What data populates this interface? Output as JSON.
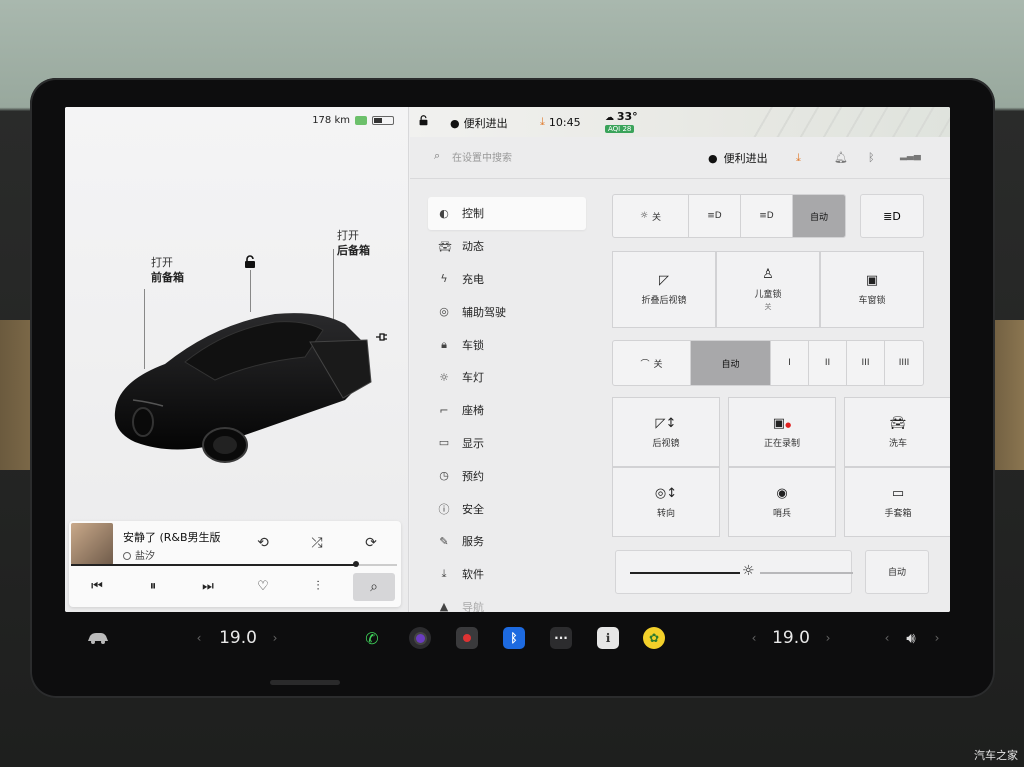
{
  "vehicle": {
    "range": "178 km",
    "frunk_callout": {
      "action": "打开",
      "target": "前备箱"
    },
    "trunk_callout": {
      "action": "打开",
      "target": "后备箱"
    },
    "lock_icon": "unlock-icon",
    "charge_icon": "charge-port-icon"
  },
  "media": {
    "title": "安静了 (R&B男生版",
    "artist": "盐汐",
    "progress": 0.87,
    "buttons": [
      "replay-icon",
      "shuffle-icon",
      "repeat-icon",
      "prev-icon",
      "pause-icon",
      "next-icon",
      "heart-icon",
      "equalizer-icon",
      "search-icon"
    ]
  },
  "status_bar": {
    "profile": "便利进出",
    "time": "10:45",
    "temperature": "33°",
    "aqi": "AQI 28"
  },
  "search": {
    "placeholder": "在设置中搜索",
    "profile": "便利进出"
  },
  "nav": [
    {
      "label": "控制",
      "icon": "toggle-icon",
      "active": true
    },
    {
      "label": "动态",
      "icon": "car-icon"
    },
    {
      "label": "充电",
      "icon": "bolt-icon"
    },
    {
      "label": "辅助驾驶",
      "icon": "steering-wheel-icon"
    },
    {
      "label": "车锁",
      "icon": "lock-icon"
    },
    {
      "label": "车灯",
      "icon": "light-icon"
    },
    {
      "label": "座椅",
      "icon": "seat-icon"
    },
    {
      "label": "显示",
      "icon": "display-icon"
    },
    {
      "label": "预约",
      "icon": "clock-icon"
    },
    {
      "label": "安全",
      "icon": "info-icon"
    },
    {
      "label": "服务",
      "icon": "wrench-icon"
    },
    {
      "label": "软件",
      "icon": "download-icon"
    },
    {
      "label": "导航",
      "icon": "navigation-icon"
    }
  ],
  "lights": {
    "off": "关",
    "auto": "自动",
    "active": "自动"
  },
  "tiles_row1": [
    {
      "label": "折叠后视镜",
      "icon": "mirror-fold-icon",
      "sub": ""
    },
    {
      "label": "儿童锁",
      "icon": "child-lock-icon",
      "sub": "关"
    },
    {
      "label": "车窗锁",
      "icon": "window-lock-icon",
      "sub": ""
    }
  ],
  "wipers": {
    "off": "关",
    "auto": "自动",
    "levels": [
      "I",
      "II",
      "III",
      "IIII"
    ],
    "active": "自动"
  },
  "tiles_grid": [
    {
      "label": "后视镜",
      "icon": "mirror-adjust-icon"
    },
    {
      "label": "正在录制",
      "icon": "dashcam-icon"
    },
    {
      "label": "洗车",
      "icon": "car-wash-icon"
    },
    {
      "label": "转向",
      "icon": "steering-adjust-icon"
    },
    {
      "label": "哨兵",
      "icon": "sentry-icon"
    },
    {
      "label": "手套箱",
      "icon": "glovebox-icon"
    }
  ],
  "brightness": {
    "value": 0.26,
    "auto": "自动"
  },
  "dock": {
    "driver_temp": "19.0",
    "passenger_temp": "19.0",
    "apps": [
      "phone-icon",
      "camera-icon",
      "dashcam-app-icon",
      "bluetooth-icon",
      "more-icon",
      "info-app-icon",
      "toybox-icon"
    ],
    "volume_icon": "volume-icon"
  },
  "watermark": "汽车之家",
  "colors": {
    "accent_orange": "#e07a2c",
    "record_red": "#e02020",
    "aqi_green": "#3aa35a"
  }
}
